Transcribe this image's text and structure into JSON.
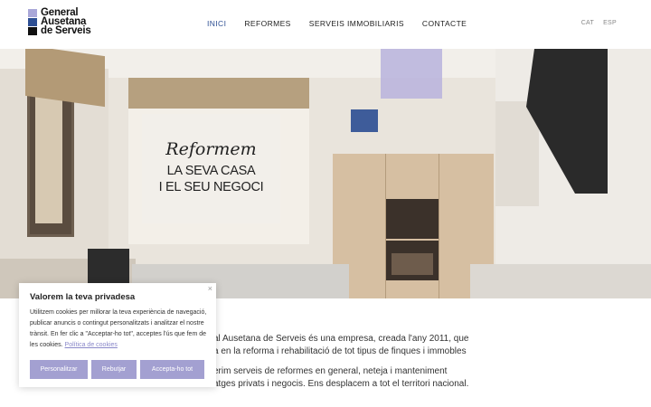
{
  "logo": {
    "line1": "General",
    "line2": "Ausetana",
    "line3": "de Serveis"
  },
  "nav": {
    "items": [
      "INICI",
      "REFORMES",
      "SERVEIS IMMOBILIARIS",
      "CONTACTE"
    ],
    "active_index": 0
  },
  "lang": {
    "cat": "CAT",
    "esp": "ESP"
  },
  "hero": {
    "script": "Reformem",
    "line1": "LA SEVA CASA",
    "line2": "I EL SEU NEGOCI"
  },
  "intro": {
    "p1_line1": "al Ausetana de Serveis és una empresa, creada l'any 2011, que",
    "p1_line2": "a en la reforma i rehabilitació de tot tipus de finques i immobles",
    "p2_line1": "erim serveis de reformes en general, neteja i manteniment",
    "p2_line2": "atges privats i negocis. Ens desplacem a tot el territori nacional."
  },
  "cookie": {
    "close": "×",
    "title": "Valorem la teva privadesa",
    "body": "Utilitzem cookies per millorar la teva experiència de navegació, publicar anuncis o contingut personalitzats i analitzar el nostre trànsit. En fer clic a \"Acceptar-ho tot\", acceptes l'ús que fem de les cookies.",
    "link": "Política de cookies",
    "btn_customize": "Personalitzar",
    "btn_reject": "Rebutjar",
    "btn_accept": "Accepta-ho tot"
  },
  "colors": {
    "accent_purple": "#a3a0d1",
    "brand_blue": "#2e4f93",
    "logo_purple": "#a9a7d8"
  }
}
